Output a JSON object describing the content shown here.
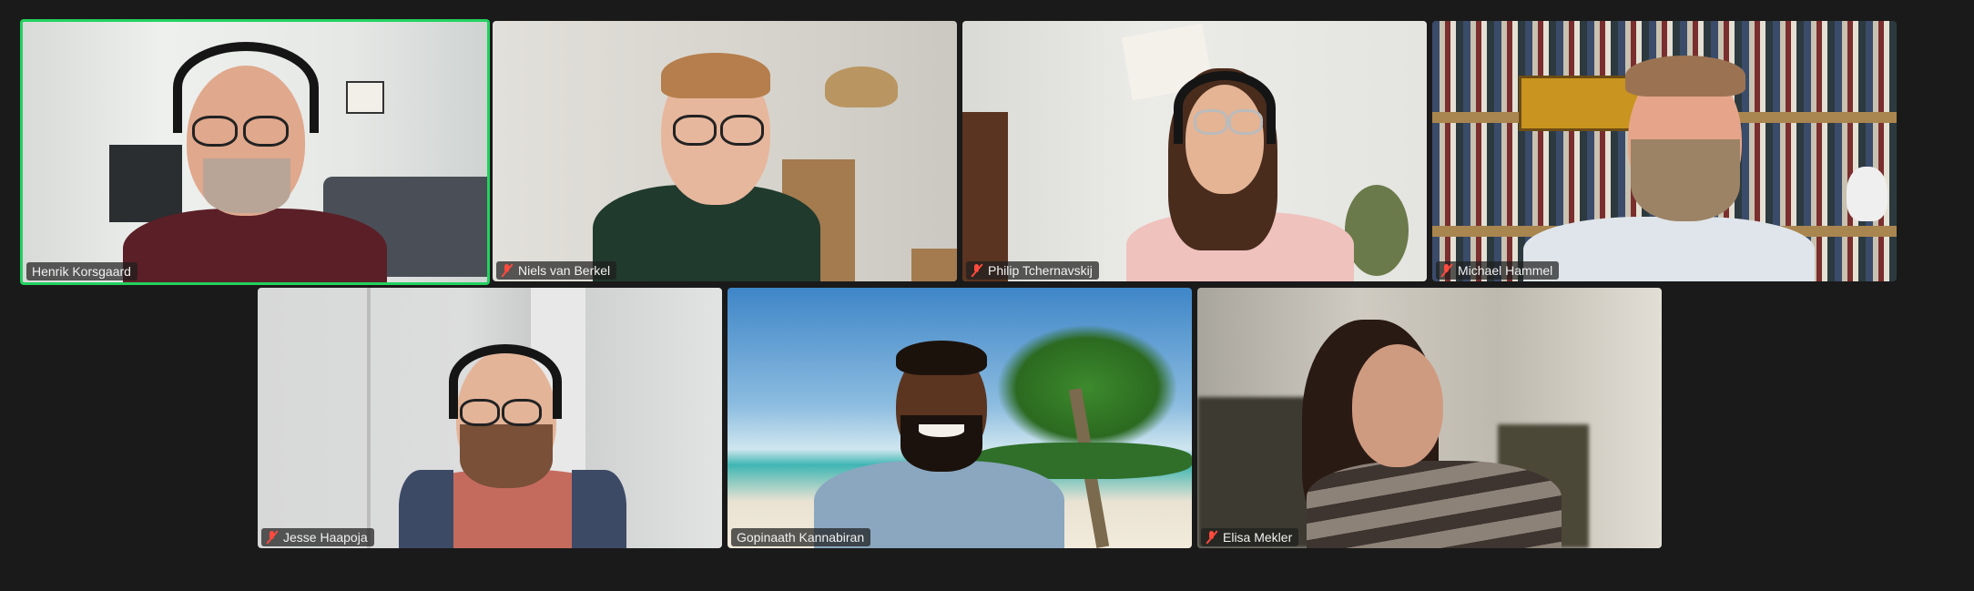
{
  "participants": [
    {
      "name": "Henrik Korsgaard",
      "muted": false,
      "active": true
    },
    {
      "name": "Niels van Berkel",
      "muted": true,
      "active": false
    },
    {
      "name": "Philip Tchernavskij",
      "muted": true,
      "active": false
    },
    {
      "name": "Michael Hammel",
      "muted": true,
      "active": false
    },
    {
      "name": "Jesse Haapoja",
      "muted": true,
      "active": false
    },
    {
      "name": "Gopinaath Kannabiran",
      "muted": false,
      "active": false
    },
    {
      "name": "Elisa Mekler",
      "muted": true,
      "active": false
    }
  ],
  "colors": {
    "active_speaker_border": "#23d160",
    "muted_icon": "#ff4a3d",
    "background": "#1a1a1a"
  }
}
